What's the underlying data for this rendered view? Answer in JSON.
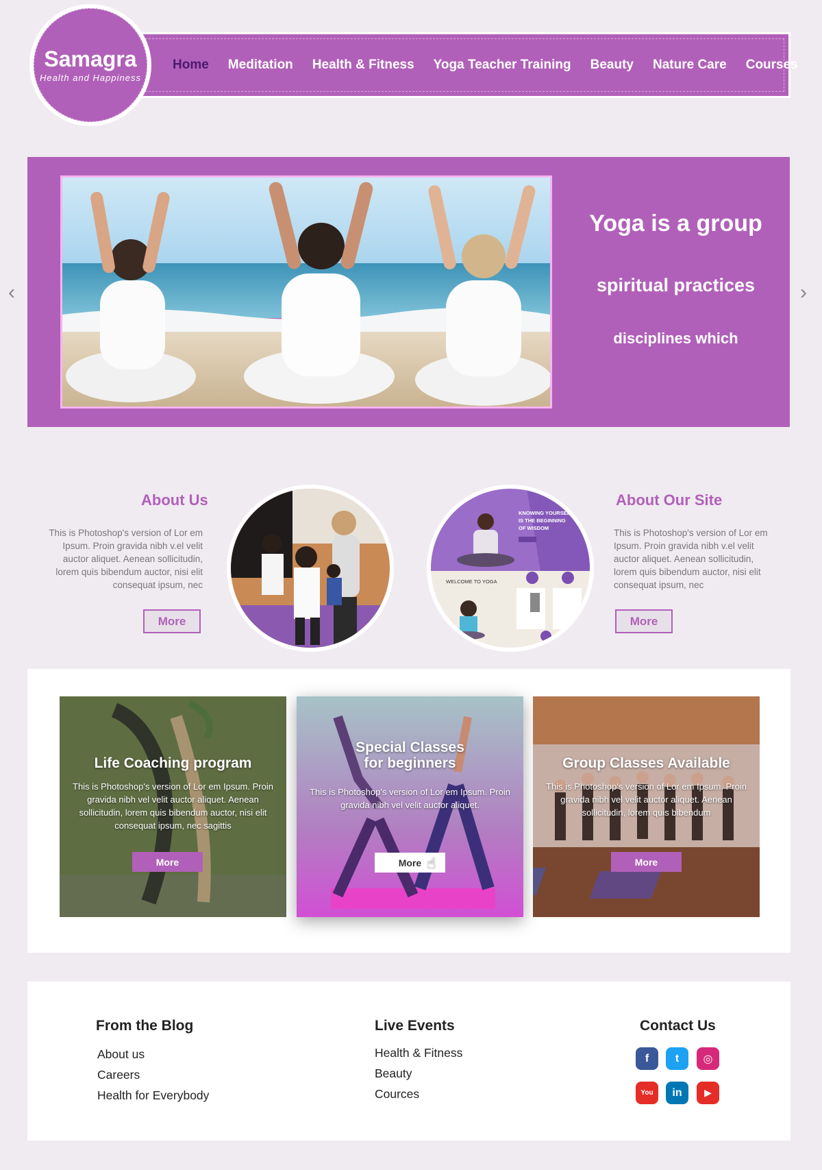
{
  "brand": {
    "name": "Samagra",
    "tagline": "Health and Happiness",
    "color": "#b160b9"
  },
  "nav": {
    "items": [
      {
        "label": "Home",
        "active": true
      },
      {
        "label": "Meditation",
        "active": false
      },
      {
        "label": "Health & Fitness",
        "active": false
      },
      {
        "label": "Yoga Teacher Training",
        "active": false
      },
      {
        "label": "Beauty",
        "active": false
      },
      {
        "label": "Nature Care",
        "active": false
      },
      {
        "label": "Courses",
        "active": false
      }
    ]
  },
  "hero": {
    "line1": "Yoga is a group",
    "line2": "spiritual practices",
    "line3": "disciplines which",
    "prev_icon": "chevron-left-icon",
    "next_icon": "chevron-right-icon",
    "prev_glyph": "‹",
    "next_glyph": "›"
  },
  "about_us": {
    "title": "About Us",
    "body": "This is Photoshop's version  of Lor em Ipsum. Proin gravida nibh v.el velit auctor aliquet. Aenean sollicitudin, lorem quis bibendum auctor, nisi elit consequat ipsum, nec",
    "button": "More"
  },
  "about_site": {
    "title": "About Our Site",
    "body": "This is Photoshop's version  of Lor em Ipsum. Proin gravida nibh v.el velit auctor aliquet. Aenean sollicitudin, lorem quis bibendum auctor, nisi elit consequat ipsum, nec",
    "button": "More",
    "thumb_banner": "KNOWING YOURSELF IS THE BEGINNING OF WISDOM",
    "thumb_welcome": "WELCOME TO YOGA"
  },
  "cards": [
    {
      "title": "Life Coaching program",
      "body": "This is Photoshop's version  of Lor  em Ipsum. Proin gravida nibh vel velit auctor aliquet. Aenean sollicitudin, lorem quis bibendum auctor, nisi elit consequat ipsum, nec sagittis",
      "button": "More"
    },
    {
      "title": "Special Classes for beginners",
      "body": "This is Photoshop's version  of Lor  em Ipsum. Proin gravida nibh vel velit auctor aliquet.",
      "button": "More"
    },
    {
      "title": "Group Classes Available",
      "body": "This is Photoshop's version  of Lor  em Ipsum. Proin gravida nibh vel velit auctor aliquet. Aenean sollicitudin, lorem quis bibendum",
      "button": "More"
    }
  ],
  "footer": {
    "blog": {
      "title": "From the Blog",
      "links": [
        "About us",
        "Careers",
        "Health for Everybody"
      ]
    },
    "events": {
      "title": "Live Events",
      "links": [
        "Health & Fitness",
        "Beauty",
        "Cources"
      ]
    },
    "contact": {
      "title": "Contact Us",
      "social": [
        {
          "icon": "facebook-icon",
          "glyph": "f",
          "color": "#3b5998"
        },
        {
          "icon": "twitter-icon",
          "glyph": "t",
          "color": "#1da1f2"
        },
        {
          "icon": "instagram-icon",
          "glyph": "◎",
          "color": "#d6297a"
        },
        {
          "icon": "youtube-icon",
          "glyph": "You",
          "color": "#e52d27"
        },
        {
          "icon": "linkedin-icon",
          "glyph": "in",
          "color": "#0077b5"
        },
        {
          "icon": "youtube-play-icon",
          "glyph": "▶",
          "color": "#e52d27"
        }
      ]
    }
  }
}
